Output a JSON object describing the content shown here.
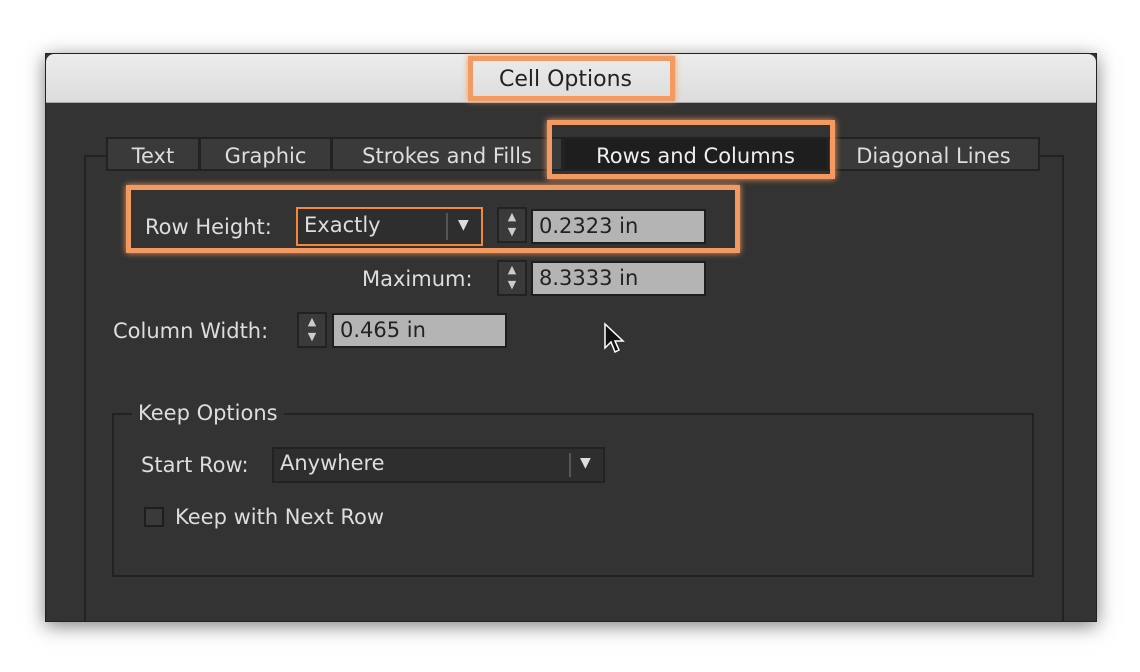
{
  "dialog": {
    "title": "Cell Options"
  },
  "tabs": [
    {
      "label": "Text"
    },
    {
      "label": "Graphic"
    },
    {
      "label": "Strokes and Fills"
    },
    {
      "label": "Rows and Columns",
      "active": true
    },
    {
      "label": "Diagonal Lines"
    }
  ],
  "row_height": {
    "label": "Row Height:",
    "mode": "Exactly",
    "value": "0.2323 in"
  },
  "maximum": {
    "label": "Maximum:",
    "value": "8.3333 in"
  },
  "column_width": {
    "label": "Column Width:",
    "value": "0.465 in"
  },
  "keep_options": {
    "legend": "Keep Options",
    "start_row_label": "Start Row:",
    "start_row_value": "Anywhere",
    "keep_with_next_label": "Keep with Next Row",
    "keep_with_next_checked": false
  },
  "colors": {
    "highlight": "#f39a62",
    "panel": "#333333",
    "field": "#b4b4b4"
  }
}
